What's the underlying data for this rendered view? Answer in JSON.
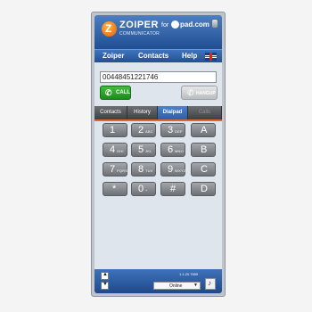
{
  "header": {
    "brand": "ZOIPER",
    "brand_sub": "COMMUNICATOR",
    "for_text": "for",
    "partner": "pad.com"
  },
  "menu": {
    "items": [
      "Zoiper",
      "Contacts",
      "Help"
    ]
  },
  "dialer": {
    "number_value": "00448451221746",
    "call_label": "CALL",
    "hangup_label": "HANGUP"
  },
  "tabs": [
    "Contacts",
    "History",
    "Dialpad",
    "Calls"
  ],
  "active_tab": "Dialpad",
  "keypad": [
    {
      "digit": "1",
      "letters": ""
    },
    {
      "digit": "2",
      "letters": "ABC"
    },
    {
      "digit": "3",
      "letters": "DEF"
    },
    {
      "digit": "A",
      "letters": ""
    },
    {
      "digit": "4",
      "letters": "GHI"
    },
    {
      "digit": "5",
      "letters": "JKL"
    },
    {
      "digit": "6",
      "letters": "MNO"
    },
    {
      "digit": "B",
      "letters": ""
    },
    {
      "digit": "7",
      "letters": "PQRS"
    },
    {
      "digit": "8",
      "letters": "TUV"
    },
    {
      "digit": "9",
      "letters": "WXYZ"
    },
    {
      "digit": "C",
      "letters": ""
    },
    {
      "digit": "*",
      "letters": ""
    },
    {
      "digit": "0",
      "letters": "+"
    },
    {
      "digit": "#",
      "letters": ""
    },
    {
      "digit": "D",
      "letters": ""
    }
  ],
  "footer": {
    "version": "1.1.20.7659",
    "status": "Online"
  },
  "icons": {
    "close": "close-icon",
    "flag": "uk-flag-icon",
    "call": "phone-icon",
    "hangup": "phone-hangup-icon",
    "up": "arrow-up-icon",
    "down": "arrow-down-icon",
    "audio": "audio-settings-icon"
  },
  "colors": {
    "header_blue": "#2b5ea6",
    "call_green": "#22a01f",
    "tab_accent": "#e0672c"
  }
}
